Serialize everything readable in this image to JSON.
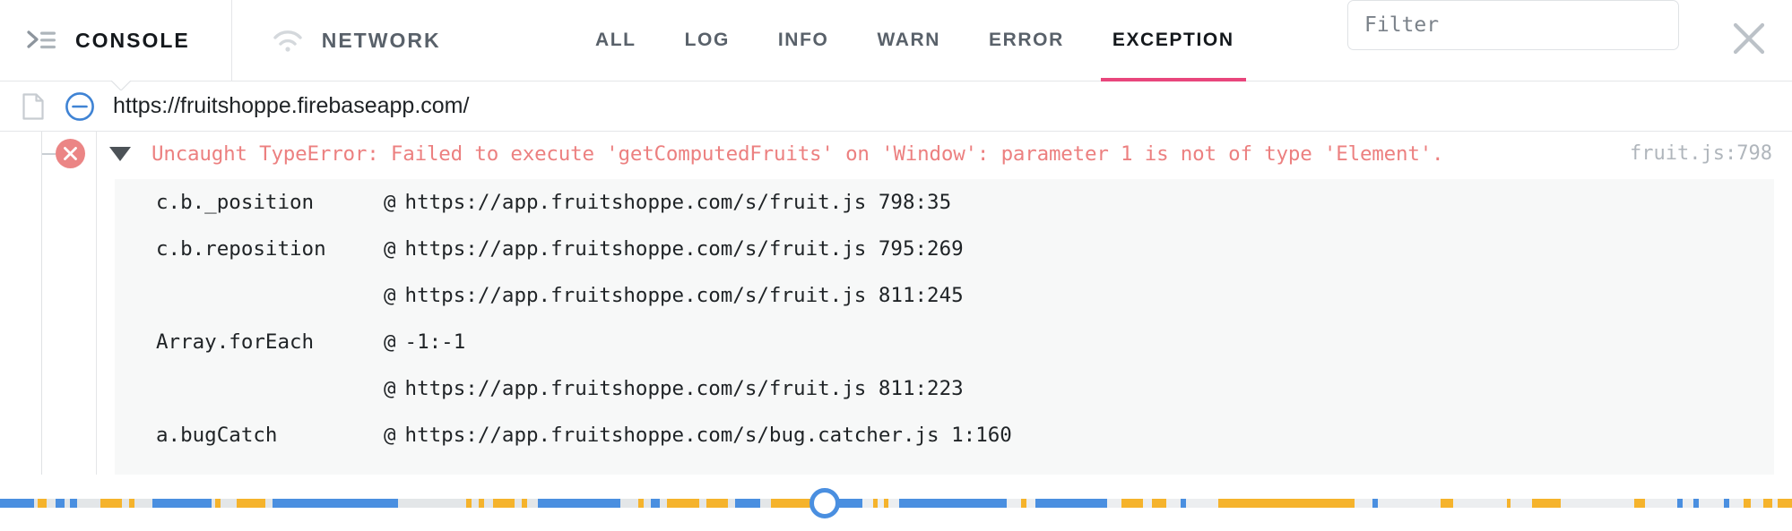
{
  "toolbar": {
    "panels": [
      {
        "label": "CONSOLE",
        "icon": "console-icon",
        "active": true
      },
      {
        "label": "NETWORK",
        "icon": "wifi-icon",
        "active": false
      }
    ],
    "level_filters": [
      {
        "label": "ALL",
        "selected": false
      },
      {
        "label": "LOG",
        "selected": false
      },
      {
        "label": "INFO",
        "selected": false
      },
      {
        "label": "WARN",
        "selected": false
      },
      {
        "label": "ERROR",
        "selected": false
      },
      {
        "label": "EXCEPTION",
        "selected": true
      }
    ],
    "filter_input": {
      "value": "",
      "placeholder": "Filter"
    },
    "close_label": "close-icon",
    "accent_color": "#e8467c"
  },
  "url_row": {
    "doc_icon": "document-icon",
    "collapse_icon": "minus-circle-icon",
    "url": "https://fruitshoppe.firebaseapp.com/"
  },
  "log": {
    "entry": {
      "severity_icon": "error-circle-x-icon",
      "expanded": true,
      "message": "Uncaught TypeError: Failed to execute 'getComputedFruits' on 'Window': parameter 1 is not of type 'Element'.",
      "source": "fruit.js:798",
      "message_color": "#ec8080"
    },
    "stack": [
      {
        "fn": "c.b._position",
        "at": "@",
        "loc": "https://app.fruitshoppe.com/s/fruit.js 798:35"
      },
      {
        "fn": "c.b.reposition",
        "at": "@",
        "loc": "https://app.fruitshoppe.com/s/fruit.js 795:269"
      },
      {
        "fn": "",
        "at": "@",
        "loc": "https://app.fruitshoppe.com/s/fruit.js 811:245"
      },
      {
        "fn": "Array.forEach",
        "at": "@",
        "loc": "-1:-1"
      },
      {
        "fn": "",
        "at": "@",
        "loc": "https://app.fruitshoppe.com/s/fruit.js 811:223"
      },
      {
        "fn": "a.bugCatch",
        "at": "@",
        "loc": "https://app.fruitshoppe.com/s/bug.catcher.js 1:160"
      }
    ]
  },
  "timeline": {
    "handle_position_pct": 46.0,
    "colors": {
      "blue": "#4a8fe0",
      "orange": "#f5b32c",
      "grey_past": "#e3e6e8",
      "grey_future": "#eceef0"
    },
    "segments": [
      {
        "x": 0.0,
        "w": 1.9,
        "c": "blue"
      },
      {
        "x": 2.1,
        "w": 0.5,
        "c": "orange"
      },
      {
        "x": 3.1,
        "w": 0.5,
        "c": "blue"
      },
      {
        "x": 3.9,
        "w": 0.4,
        "c": "blue"
      },
      {
        "x": 5.6,
        "w": 1.2,
        "c": "orange"
      },
      {
        "x": 7.2,
        "w": 0.3,
        "c": "orange"
      },
      {
        "x": 8.5,
        "w": 3.3,
        "c": "blue"
      },
      {
        "x": 12.0,
        "w": 0.3,
        "c": "orange"
      },
      {
        "x": 13.2,
        "w": 1.6,
        "c": "orange"
      },
      {
        "x": 15.2,
        "w": 7.0,
        "c": "blue"
      },
      {
        "x": 26.0,
        "w": 0.3,
        "c": "orange"
      },
      {
        "x": 26.7,
        "w": 0.3,
        "c": "orange"
      },
      {
        "x": 27.5,
        "w": 1.2,
        "c": "orange"
      },
      {
        "x": 29.1,
        "w": 0.3,
        "c": "orange"
      },
      {
        "x": 30.0,
        "w": 4.6,
        "c": "blue"
      },
      {
        "x": 35.6,
        "w": 0.3,
        "c": "orange"
      },
      {
        "x": 36.3,
        "w": 0.5,
        "c": "blue"
      },
      {
        "x": 37.2,
        "w": 1.8,
        "c": "orange"
      },
      {
        "x": 39.4,
        "w": 1.2,
        "c": "orange"
      },
      {
        "x": 41.0,
        "w": 1.4,
        "c": "blue"
      },
      {
        "x": 43.0,
        "w": 2.6,
        "c": "orange"
      },
      {
        "x": 46.2,
        "w": 1.9,
        "c": "blue"
      },
      {
        "x": 48.7,
        "w": 0.3,
        "c": "orange"
      },
      {
        "x": 49.3,
        "w": 0.3,
        "c": "orange"
      },
      {
        "x": 50.2,
        "w": 6.0,
        "c": "blue"
      },
      {
        "x": 57.0,
        "w": 0.3,
        "c": "orange"
      },
      {
        "x": 57.8,
        "w": 4.0,
        "c": "blue"
      },
      {
        "x": 62.6,
        "w": 1.2,
        "c": "orange"
      },
      {
        "x": 64.3,
        "w": 0.8,
        "c": "orange"
      },
      {
        "x": 65.9,
        "w": 0.3,
        "c": "blue"
      },
      {
        "x": 68.0,
        "w": 7.6,
        "c": "orange"
      },
      {
        "x": 76.6,
        "w": 0.3,
        "c": "blue"
      },
      {
        "x": 80.4,
        "w": 0.7,
        "c": "orange"
      },
      {
        "x": 84.1,
        "w": 0.2,
        "c": "orange"
      },
      {
        "x": 85.5,
        "w": 1.6,
        "c": "orange"
      },
      {
        "x": 91.2,
        "w": 0.6,
        "c": "orange"
      },
      {
        "x": 93.6,
        "w": 0.3,
        "c": "blue"
      },
      {
        "x": 94.5,
        "w": 0.3,
        "c": "blue"
      },
      {
        "x": 96.2,
        "w": 0.3,
        "c": "blue"
      },
      {
        "x": 97.3,
        "w": 0.4,
        "c": "orange"
      },
      {
        "x": 98.4,
        "w": 0.5,
        "c": "orange"
      },
      {
        "x": 99.2,
        "w": 0.8,
        "c": "orange"
      }
    ]
  }
}
